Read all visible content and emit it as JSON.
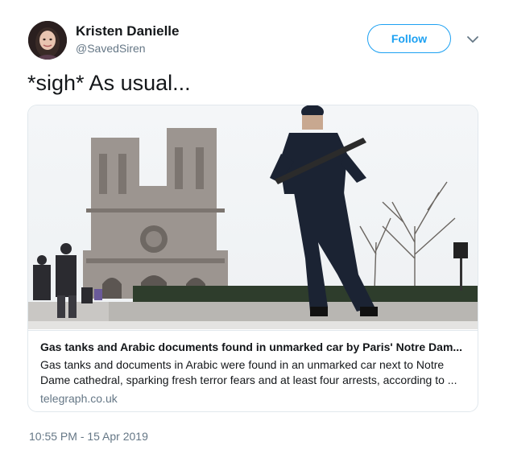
{
  "user": {
    "display_name": "Kristen Danielle",
    "handle": "@SavedSiren",
    "avatar_icon": "profile-photo"
  },
  "actions": {
    "follow_label": "Follow",
    "more_icon": "chevron-down-icon"
  },
  "tweet": {
    "text": "*sigh* As usual...",
    "timestamp": "10:55 PM - 15 Apr 2019"
  },
  "card": {
    "title": "Gas tanks and Arabic documents found in unmarked car by Paris' Notre Dam...",
    "description_line1": "Gas tanks and documents in Arabic were found in an unmarked car next to Notre",
    "description_line2": "Dame cathedral, sparking fresh terror fears and at least four arrests, according to ...",
    "domain": "telegraph.co.uk"
  },
  "colors": {
    "accent": "#1da1f2",
    "muted": "#657786",
    "border": "#e1e8ed"
  }
}
